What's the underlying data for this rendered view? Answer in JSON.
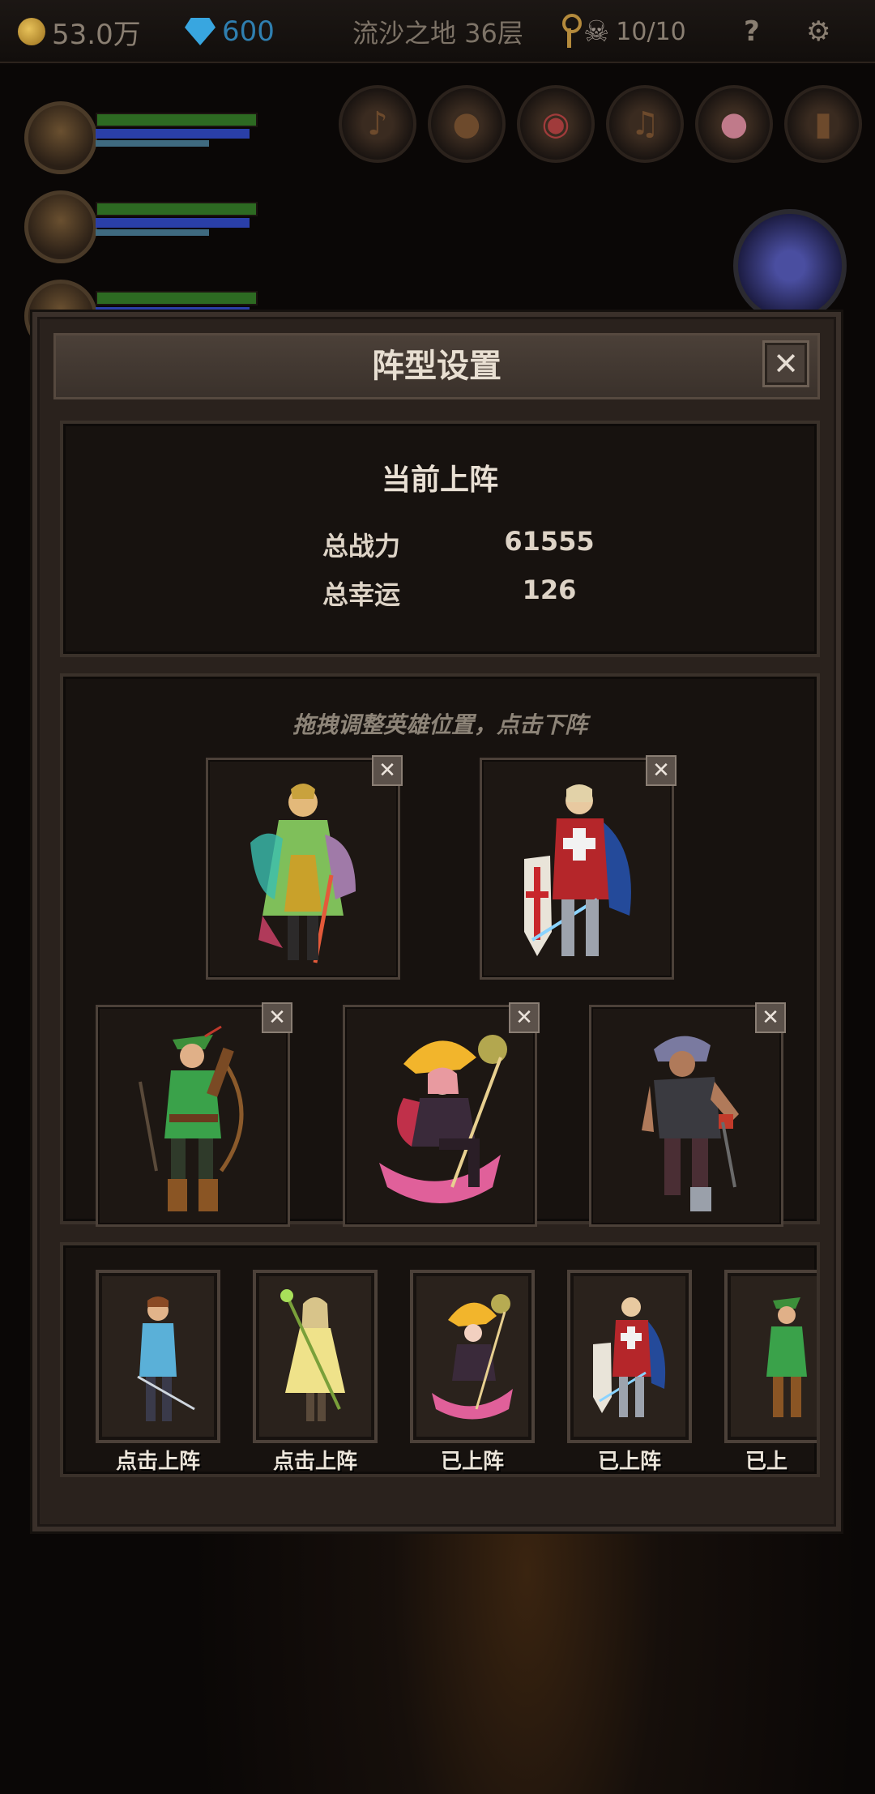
{
  "hud": {
    "gold": "53.0万",
    "gems": "600",
    "stage": "流沙之地 36层",
    "keys_count": "10/10",
    "help_label": "?"
  },
  "modal": {
    "title": "阵型设置",
    "close_label": "✕",
    "stats": {
      "title": "当前上阵",
      "power_label": "总战力",
      "power_value": "61555",
      "luck_label": "总幸运",
      "luck_value": "126"
    },
    "formation": {
      "hint": "拖拽调整英雄位置，点击下阵",
      "slots": [
        {
          "hero_icon": "green-mage-hero",
          "remove_label": "✕"
        },
        {
          "hero_icon": "crusader-knight-hero",
          "remove_label": "✕"
        },
        {
          "hero_icon": "archer-ranger-hero",
          "remove_label": "✕"
        },
        {
          "hero_icon": "witch-broom-hero",
          "remove_label": "✕"
        },
        {
          "hero_icon": "brawler-warrior-hero",
          "remove_label": "✕"
        }
      ]
    },
    "roster": [
      {
        "hero_icon": "swordsman-blue-hero",
        "label": "点击上阵"
      },
      {
        "hero_icon": "staff-priestess-hero",
        "label": "点击上阵"
      },
      {
        "hero_icon": "witch-broom-hero",
        "label": "已上阵"
      },
      {
        "hero_icon": "crusader-knight-hero",
        "label": "已上阵"
      },
      {
        "hero_icon": "archer-ranger-hero",
        "label": "已上"
      }
    ]
  },
  "colors": {
    "accent_gold": "#b48a3c",
    "gem_blue": "#38a6e0",
    "panel_dark": "#17120f"
  }
}
